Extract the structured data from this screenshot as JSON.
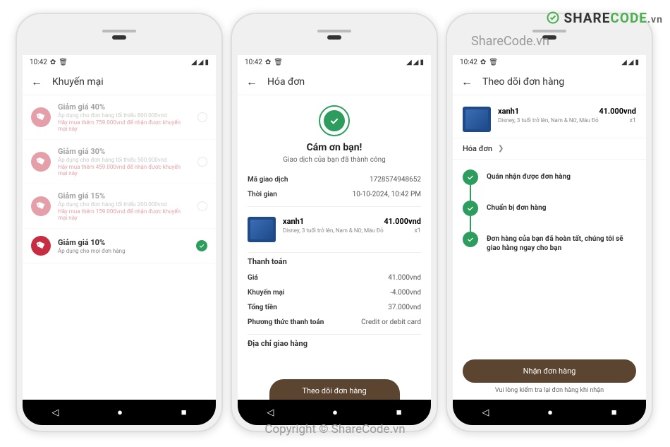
{
  "watermarks": {
    "top_left": "ShareCode.vn",
    "copyright": "Copyright © ShareCode.vn",
    "logo_share": "SHARE",
    "logo_code": "CODE",
    "logo_vn": ".vn"
  },
  "status": {
    "time": "10:42"
  },
  "screen1": {
    "title": "Khuyến mại",
    "promos": [
      {
        "title": "Giảm giá 40%",
        "sub": "Áp dụng cho đơn hàng tối thiểu 800.000vnd",
        "warn": "Hãy mua thêm 759.000vnd để nhận được khuyến mại này",
        "faded": true
      },
      {
        "title": "Giảm giá 30%",
        "sub": "Áp dụng cho đơn hàng tối thiểu 500.000vnd",
        "warn": "Hãy mua thêm 459.000vnd để nhận được khuyến mại này",
        "faded": true
      },
      {
        "title": "Giảm giá 15%",
        "sub": "Áp dụng cho đơn hàng tối thiểu 200.000vnd",
        "warn": "Hãy mua thêm 159.000vnd để nhận được khuyến mại này",
        "faded": true
      },
      {
        "title": "Giảm giá 10%",
        "sub": "Áp dụng cho mọi đơn hàng",
        "warn": "",
        "faded": false
      }
    ]
  },
  "screen2": {
    "title": "Hóa đơn",
    "thank": "Cám ơn bạn!",
    "sub": "Giao dịch của bạn đã thành công",
    "tx_id_lbl": "Mã giao dịch",
    "tx_id_val": "1728574948652",
    "time_lbl": "Thời gian",
    "time_val": "10-10-2024, 10:42 PM",
    "product": {
      "name": "xanh1",
      "price": "41.000vnd",
      "desc": "Disney, 3 tuổi trở lên, Nam & Nữ, Màu Đỏ",
      "qty": "x1"
    },
    "payment_lbl": "Thanh toán",
    "rows": [
      {
        "lbl": "Giá",
        "val": "41.000vnd"
      },
      {
        "lbl": "Khuyến mại",
        "val": "-4.000vnd"
      },
      {
        "lbl": "Tổng tiền",
        "val": "37.000vnd"
      },
      {
        "lbl": "Phương thức thanh toán",
        "val": "Credit or debit card"
      }
    ],
    "addr_lbl": "Địa chỉ giao hàng",
    "track_btn": "Theo dõi đơn hàng"
  },
  "screen3": {
    "title": "Theo dõi đơn hàng",
    "product": {
      "name": "xanh1",
      "price": "41.000vnd",
      "desc": "Disney, 3 tuổi trở lên, Nam & Nữ, Màu Đỏ",
      "qty": "x1"
    },
    "invoice_lbl": "Hóa đơn",
    "steps": [
      "Quán nhận được đơn hàng",
      "Chuẩn bị đơn hàng",
      "Đơn hàng của bạn đã hoàn tất, chúng tôi sẽ giao hàng ngay cho bạn"
    ],
    "receive_btn": "Nhận đơn hàng",
    "note": "Vui lòng kiểm tra lại đơn hàng khi nhận"
  }
}
